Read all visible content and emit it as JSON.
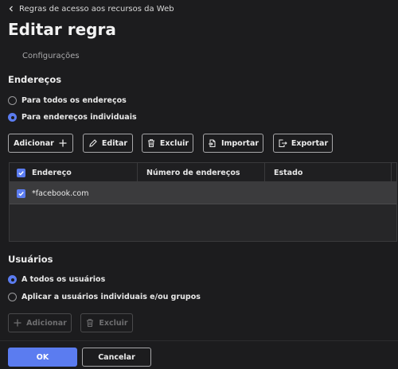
{
  "breadcrumb": {
    "label": "Regras de acesso aos recursos da Web",
    "icon": "chevron-left-icon"
  },
  "page": {
    "title": "Editar regra"
  },
  "tabs": [
    {
      "label": "Configurações",
      "active": true
    }
  ],
  "addresses": {
    "title": "Endereços",
    "options": [
      {
        "label": "Para todos os endereços",
        "selected": false
      },
      {
        "label": "Para endereços individuais",
        "selected": true
      }
    ],
    "toolbar": {
      "add_label": "Adicionar",
      "edit_label": "Editar",
      "delete_label": "Excluir",
      "import_label": "Importar",
      "export_label": "Exportar"
    },
    "table": {
      "columns": [
        "Endereço",
        "Número de endereços",
        "Estado"
      ],
      "rows": [
        {
          "address": "*facebook.com",
          "count": "",
          "state": "",
          "checked": true
        }
      ],
      "header_checked": true
    }
  },
  "users": {
    "title": "Usuários",
    "options": [
      {
        "label": "A todos os usuários",
        "selected": true
      },
      {
        "label": "Aplicar a usuários individuais e/ou grupos",
        "selected": false
      }
    ],
    "toolbar": {
      "add_label": "Adicionar",
      "delete_label": "Excluir",
      "disabled": true
    }
  },
  "footer": {
    "ok_label": "OK",
    "cancel_label": "Cancelar"
  },
  "colors": {
    "accent": "#5b7cf0",
    "background": "#1c1c1e",
    "selected_row": "#3b3b3d"
  }
}
